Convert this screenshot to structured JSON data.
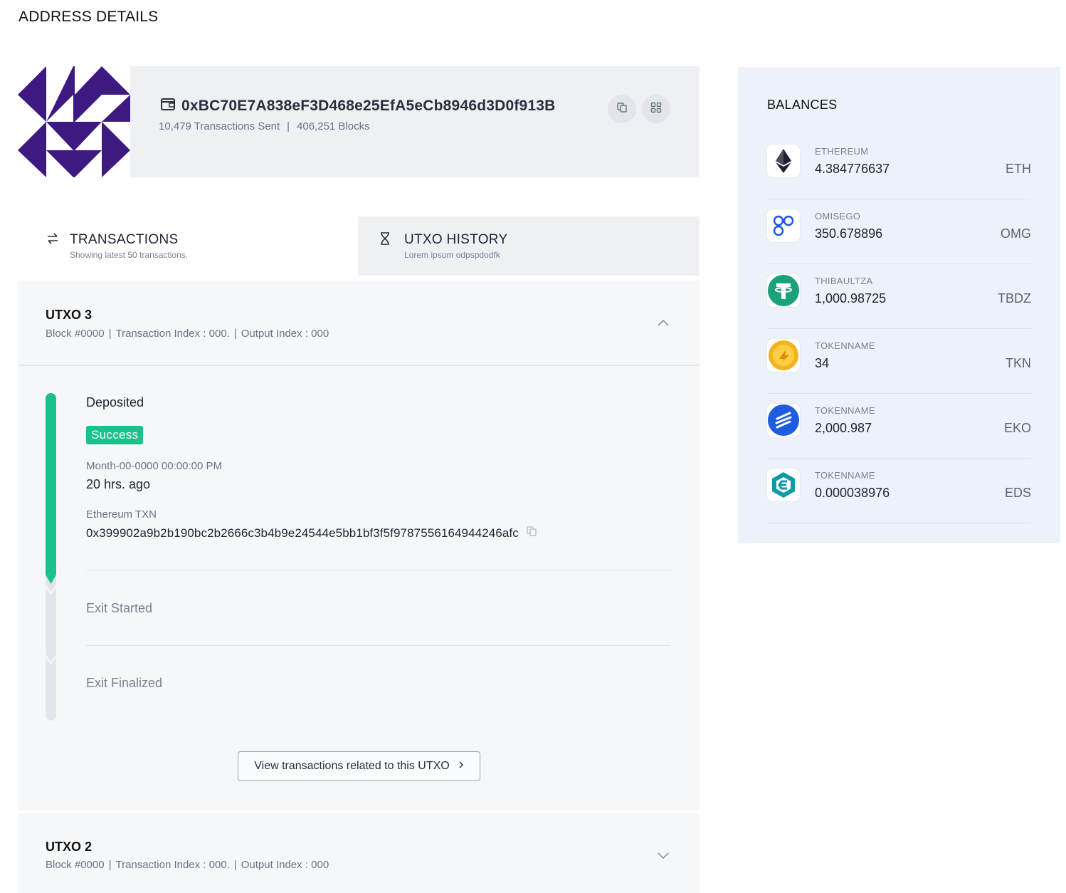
{
  "page": {
    "title": "ADDRESS DETAILS"
  },
  "address": {
    "value": "0xBC70E7A838eF3D468e25EfA5eCb8946d3D0f913B",
    "transactions_sent": "10,479 Transactions Sent",
    "separator": "|",
    "blocks": "406,251 Blocks"
  },
  "tabs": [
    {
      "label": "TRANSACTIONS",
      "subtitle": "Showing latest 50 transactions.",
      "icon": "swap-arrows-icon",
      "active": true
    },
    {
      "label": "UTXO HISTORY",
      "subtitle": "Lorem ipsum odpspdodfk",
      "icon": "hourglass-icon",
      "active": false
    }
  ],
  "utxos": [
    {
      "title": "UTXO 3",
      "block": "Block #0000",
      "tx_index": "Transaction Index : 000.",
      "output_index": "Output Index : 000",
      "expanded": true,
      "progress_fraction": 0.33,
      "steps": {
        "deposited": "Deposited",
        "status": "Success",
        "date": "Month-00-0000 00:00:00 PM",
        "relative": "20 hrs. ago",
        "txn_label": "Ethereum TXN",
        "txn_hash": "0x399902a9b2b190bc2b2666c3b4b9e24544e5bb1bf3f5f9787556164944246afc",
        "exit_started": "Exit Started",
        "exit_finalized": "Exit Finalized"
      },
      "view_button": "View transactions related to this UTXO"
    },
    {
      "title": "UTXO 2",
      "block": "Block #0000",
      "tx_index": "Transaction Index : 000.",
      "output_index": "Output Index : 000",
      "expanded": false
    }
  ],
  "balances": {
    "title": "BALANCES",
    "items": [
      {
        "name": "ETHEREUM",
        "amount": "4.384776637",
        "symbol": "ETH",
        "icon": "ethereum-icon"
      },
      {
        "name": "OMISEGO",
        "amount": "350.678896",
        "symbol": "OMG",
        "icon": "omisego-icon"
      },
      {
        "name": "THIBAULTZA",
        "amount": "1,000.98725",
        "symbol": "TBDZ",
        "icon": "tether-icon"
      },
      {
        "name": "TOKENNAME",
        "amount": "34",
        "symbol": "TKN",
        "icon": "gold-token-icon"
      },
      {
        "name": "TOKENNAME",
        "amount": "2,000.987",
        "symbol": "EKO",
        "icon": "eko-icon"
      },
      {
        "name": "TOKENNAME",
        "amount": "0.000038976",
        "symbol": "EDS",
        "icon": "eds-icon"
      }
    ]
  },
  "colors": {
    "accent_green": "#1bc08a",
    "avatar_purple": "#3d1a82",
    "panel_grey": "#eef0f4",
    "balances_bg": "#edf1f9"
  }
}
